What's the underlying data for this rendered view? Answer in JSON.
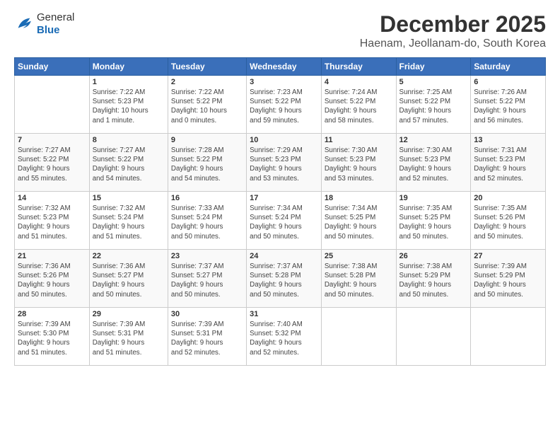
{
  "header": {
    "logo_general": "General",
    "logo_blue": "Blue",
    "title": "December 2025",
    "subtitle": "Haenam, Jeollanam-do, South Korea"
  },
  "columns": [
    "Sunday",
    "Monday",
    "Tuesday",
    "Wednesday",
    "Thursday",
    "Friday",
    "Saturday"
  ],
  "weeks": [
    [
      {
        "day": "",
        "info": ""
      },
      {
        "day": "1",
        "info": "Sunrise: 7:22 AM\nSunset: 5:23 PM\nDaylight: 10 hours\nand 1 minute."
      },
      {
        "day": "2",
        "info": "Sunrise: 7:22 AM\nSunset: 5:22 PM\nDaylight: 10 hours\nand 0 minutes."
      },
      {
        "day": "3",
        "info": "Sunrise: 7:23 AM\nSunset: 5:22 PM\nDaylight: 9 hours\nand 59 minutes."
      },
      {
        "day": "4",
        "info": "Sunrise: 7:24 AM\nSunset: 5:22 PM\nDaylight: 9 hours\nand 58 minutes."
      },
      {
        "day": "5",
        "info": "Sunrise: 7:25 AM\nSunset: 5:22 PM\nDaylight: 9 hours\nand 57 minutes."
      },
      {
        "day": "6",
        "info": "Sunrise: 7:26 AM\nSunset: 5:22 PM\nDaylight: 9 hours\nand 56 minutes."
      }
    ],
    [
      {
        "day": "7",
        "info": "Sunrise: 7:27 AM\nSunset: 5:22 PM\nDaylight: 9 hours\nand 55 minutes."
      },
      {
        "day": "8",
        "info": "Sunrise: 7:27 AM\nSunset: 5:22 PM\nDaylight: 9 hours\nand 54 minutes."
      },
      {
        "day": "9",
        "info": "Sunrise: 7:28 AM\nSunset: 5:22 PM\nDaylight: 9 hours\nand 54 minutes."
      },
      {
        "day": "10",
        "info": "Sunrise: 7:29 AM\nSunset: 5:23 PM\nDaylight: 9 hours\nand 53 minutes."
      },
      {
        "day": "11",
        "info": "Sunrise: 7:30 AM\nSunset: 5:23 PM\nDaylight: 9 hours\nand 53 minutes."
      },
      {
        "day": "12",
        "info": "Sunrise: 7:30 AM\nSunset: 5:23 PM\nDaylight: 9 hours\nand 52 minutes."
      },
      {
        "day": "13",
        "info": "Sunrise: 7:31 AM\nSunset: 5:23 PM\nDaylight: 9 hours\nand 52 minutes."
      }
    ],
    [
      {
        "day": "14",
        "info": "Sunrise: 7:32 AM\nSunset: 5:23 PM\nDaylight: 9 hours\nand 51 minutes."
      },
      {
        "day": "15",
        "info": "Sunrise: 7:32 AM\nSunset: 5:24 PM\nDaylight: 9 hours\nand 51 minutes."
      },
      {
        "day": "16",
        "info": "Sunrise: 7:33 AM\nSunset: 5:24 PM\nDaylight: 9 hours\nand 50 minutes."
      },
      {
        "day": "17",
        "info": "Sunrise: 7:34 AM\nSunset: 5:24 PM\nDaylight: 9 hours\nand 50 minutes."
      },
      {
        "day": "18",
        "info": "Sunrise: 7:34 AM\nSunset: 5:25 PM\nDaylight: 9 hours\nand 50 minutes."
      },
      {
        "day": "19",
        "info": "Sunrise: 7:35 AM\nSunset: 5:25 PM\nDaylight: 9 hours\nand 50 minutes."
      },
      {
        "day": "20",
        "info": "Sunrise: 7:35 AM\nSunset: 5:26 PM\nDaylight: 9 hours\nand 50 minutes."
      }
    ],
    [
      {
        "day": "21",
        "info": "Sunrise: 7:36 AM\nSunset: 5:26 PM\nDaylight: 9 hours\nand 50 minutes."
      },
      {
        "day": "22",
        "info": "Sunrise: 7:36 AM\nSunset: 5:27 PM\nDaylight: 9 hours\nand 50 minutes."
      },
      {
        "day": "23",
        "info": "Sunrise: 7:37 AM\nSunset: 5:27 PM\nDaylight: 9 hours\nand 50 minutes."
      },
      {
        "day": "24",
        "info": "Sunrise: 7:37 AM\nSunset: 5:28 PM\nDaylight: 9 hours\nand 50 minutes."
      },
      {
        "day": "25",
        "info": "Sunrise: 7:38 AM\nSunset: 5:28 PM\nDaylight: 9 hours\nand 50 minutes."
      },
      {
        "day": "26",
        "info": "Sunrise: 7:38 AM\nSunset: 5:29 PM\nDaylight: 9 hours\nand 50 minutes."
      },
      {
        "day": "27",
        "info": "Sunrise: 7:39 AM\nSunset: 5:29 PM\nDaylight: 9 hours\nand 50 minutes."
      }
    ],
    [
      {
        "day": "28",
        "info": "Sunrise: 7:39 AM\nSunset: 5:30 PM\nDaylight: 9 hours\nand 51 minutes."
      },
      {
        "day": "29",
        "info": "Sunrise: 7:39 AM\nSunset: 5:31 PM\nDaylight: 9 hours\nand 51 minutes."
      },
      {
        "day": "30",
        "info": "Sunrise: 7:39 AM\nSunset: 5:31 PM\nDaylight: 9 hours\nand 52 minutes."
      },
      {
        "day": "31",
        "info": "Sunrise: 7:40 AM\nSunset: 5:32 PM\nDaylight: 9 hours\nand 52 minutes."
      },
      {
        "day": "",
        "info": ""
      },
      {
        "day": "",
        "info": ""
      },
      {
        "day": "",
        "info": ""
      }
    ]
  ]
}
